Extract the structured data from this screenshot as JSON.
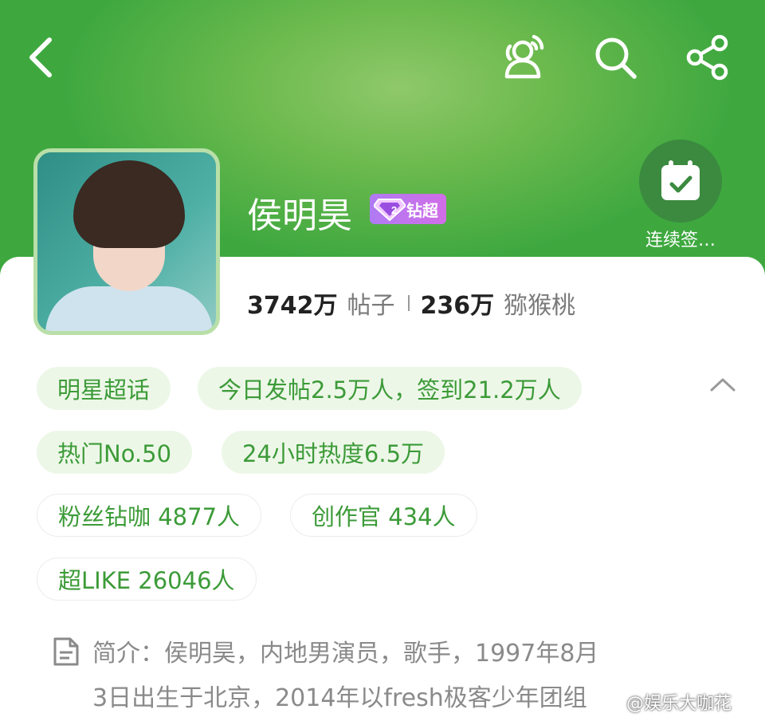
{
  "profile": {
    "name": "侯明昊",
    "badge_label": "钻超",
    "badge_level": "2"
  },
  "stats": {
    "posts_value": "3742万",
    "posts_label": "帖子",
    "fans_value": "236万",
    "fans_label": "猕猴桃"
  },
  "checkin": {
    "label": "连续签…"
  },
  "tags": {
    "category": "明星超话",
    "today": "今日发帖2.5万人，签到21.2万人",
    "rank": "热门No.50",
    "heat": "24小时热度6.5万",
    "diamond_fans": "粉丝钻咖 4877人",
    "creators": "创作官 434人",
    "super_like": "超LIKE 26046人"
  },
  "intro": {
    "line1": "简介：侯明昊，内地男演员，歌手，1997年8月",
    "line2": "3日出生于北京，2014年以fresh极客少年团组"
  },
  "watermark": "@娱乐大咖花",
  "icons": {
    "back": "back-arrow-icon",
    "chat": "chat-people-icon",
    "search": "search-icon",
    "share": "share-icon",
    "calendar": "calendar-check-icon",
    "collapse": "chevron-up-icon",
    "document": "document-icon",
    "gem": "diamond-icon"
  },
  "colors": {
    "brand_green": "#3c9b38",
    "chip_bg": "#edf7e8",
    "badge_purple": "#c275ee"
  }
}
